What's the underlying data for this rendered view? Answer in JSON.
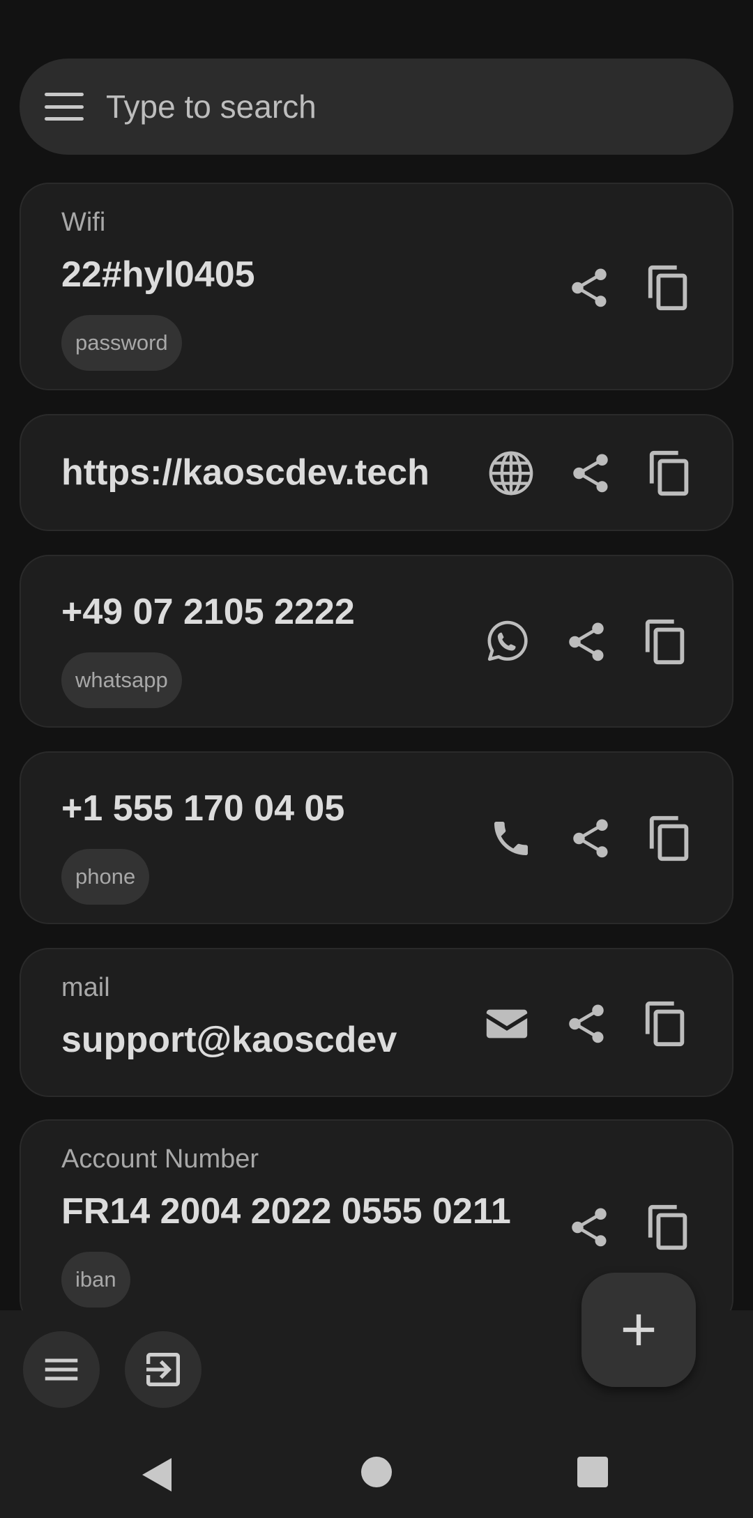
{
  "search": {
    "placeholder": "Type to search"
  },
  "entries": [
    {
      "title": "Wifi",
      "value": "22#hyl0405",
      "tag": "password",
      "actions": [
        "share-icon",
        "copy-icon"
      ]
    },
    {
      "title": "",
      "value": "https://kaoscdev.tech",
      "tag": "",
      "actions": [
        "globe-icon",
        "share-icon",
        "copy-icon"
      ]
    },
    {
      "title": "",
      "value": "+49 07 2105 2222",
      "tag": "whatsapp",
      "actions": [
        "whatsapp-icon",
        "share-icon",
        "copy-icon"
      ]
    },
    {
      "title": "",
      "value": "+1 555 170 04 05",
      "tag": "phone",
      "actions": [
        "phone-icon",
        "share-icon",
        "copy-icon"
      ]
    },
    {
      "title": "mail",
      "value": "support@kaoscdev",
      "tag": "",
      "actions": [
        "mail-icon",
        "share-icon",
        "copy-icon"
      ]
    },
    {
      "title": "Account Number",
      "value": "FR14 2004 2022 0555 0211",
      "tag": "iban",
      "actions": [
        "share-icon",
        "copy-icon"
      ]
    }
  ],
  "bottom_bar": {
    "buttons": [
      "menu-icon",
      "login-icon"
    ],
    "fab": "plus-icon"
  },
  "nav": [
    "back-icon",
    "home-icon",
    "recents-icon"
  ],
  "colors": {
    "background": "#121212",
    "card": "#1e1e1e",
    "icon": "#bdbdbd",
    "text": "#dcdcdc"
  }
}
